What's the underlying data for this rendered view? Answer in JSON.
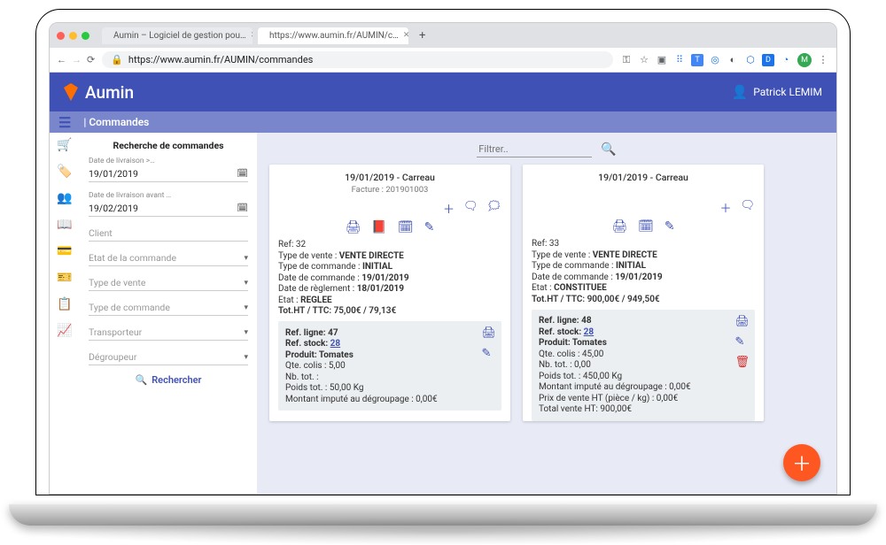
{
  "browser": {
    "tab1": "Aumin – Logiciel de gestion pou…",
    "tab2": "https://www.aumin.fr/AUMIN/c…",
    "url": "https://www.aumin.fr/AUMIN/commandes"
  },
  "header": {
    "brand": "Aumin",
    "user": "Patrick LEMIM"
  },
  "subheader": "| Commandes",
  "search": {
    "title": "Recherche de commandes",
    "date_from_label": "Date de livraison >…",
    "date_from": "19/01/2019",
    "date_to_label": "Date de livraison avant …",
    "date_to": "19/02/2019",
    "client": "Client",
    "etat": "Etat de la commande",
    "type_vente": "Type de vente",
    "type_commande": "Type de commande",
    "transporteur": "Transporteur",
    "degroupeur": "Dégroupeur",
    "btn": "Rechercher"
  },
  "filter_placeholder": "Filtrer..",
  "card1": {
    "title": "19/01/2019 - Carreau",
    "invoice": "Facture : 201901003",
    "ref": "Ref: 32",
    "sale_type_label": "Type de vente : ",
    "sale_type": "VENTE DIRECTE",
    "order_type_label": "Type de commande : ",
    "order_type": "INITIAL",
    "order_date_label": "Date de commande : ",
    "order_date": "19/01/2019",
    "pay_date_label": "Date de règlement : ",
    "pay_date": "18/01/2019",
    "state_label": "Etat : ",
    "state": "REGLEE",
    "totals": "Tot.HT / TTC: 75,00€ / 79,13€",
    "line": {
      "ref_ligne": "Ref. ligne: 47",
      "ref_stock_label": "Ref. stock: ",
      "ref_stock": "28",
      "produit": "Produit: Tomates",
      "qte": "Qte. colis : 5,00",
      "nb": "Nb. tot. : ",
      "poids": "Poids tot. : 50,00 Kg",
      "montant": "Montant imputé au dégroupage : 0,00€"
    }
  },
  "card2": {
    "title": "19/01/2019 - Carreau",
    "ref": "Ref: 33",
    "sale_type_label": "Type de vente : ",
    "sale_type": "VENTE DIRECTE",
    "order_type_label": "Type de commande : ",
    "order_type": "INITIAL",
    "order_date_label": "Date de commande : ",
    "order_date": "19/01/2019",
    "state_label": "Etat : ",
    "state": "CONSTITUEE",
    "totals": "Tot.HT / TTC: 900,00€ / 949,50€",
    "line": {
      "ref_ligne": "Ref. ligne: 48",
      "ref_stock_label": "Ref. stock: ",
      "ref_stock": "28",
      "produit": "Produit: Tomates",
      "qte": "Qte. colis : 45,00",
      "nb": "Nb. tot. : 0,00",
      "poids": "Poids tot. : 450,00 Kg",
      "montant": "Montant imputé au dégroupage : 0,00€",
      "prix": "Prix de vente HT (pièce / kg) : 0,00€",
      "total": "Total vente HT: 900,00€"
    }
  }
}
